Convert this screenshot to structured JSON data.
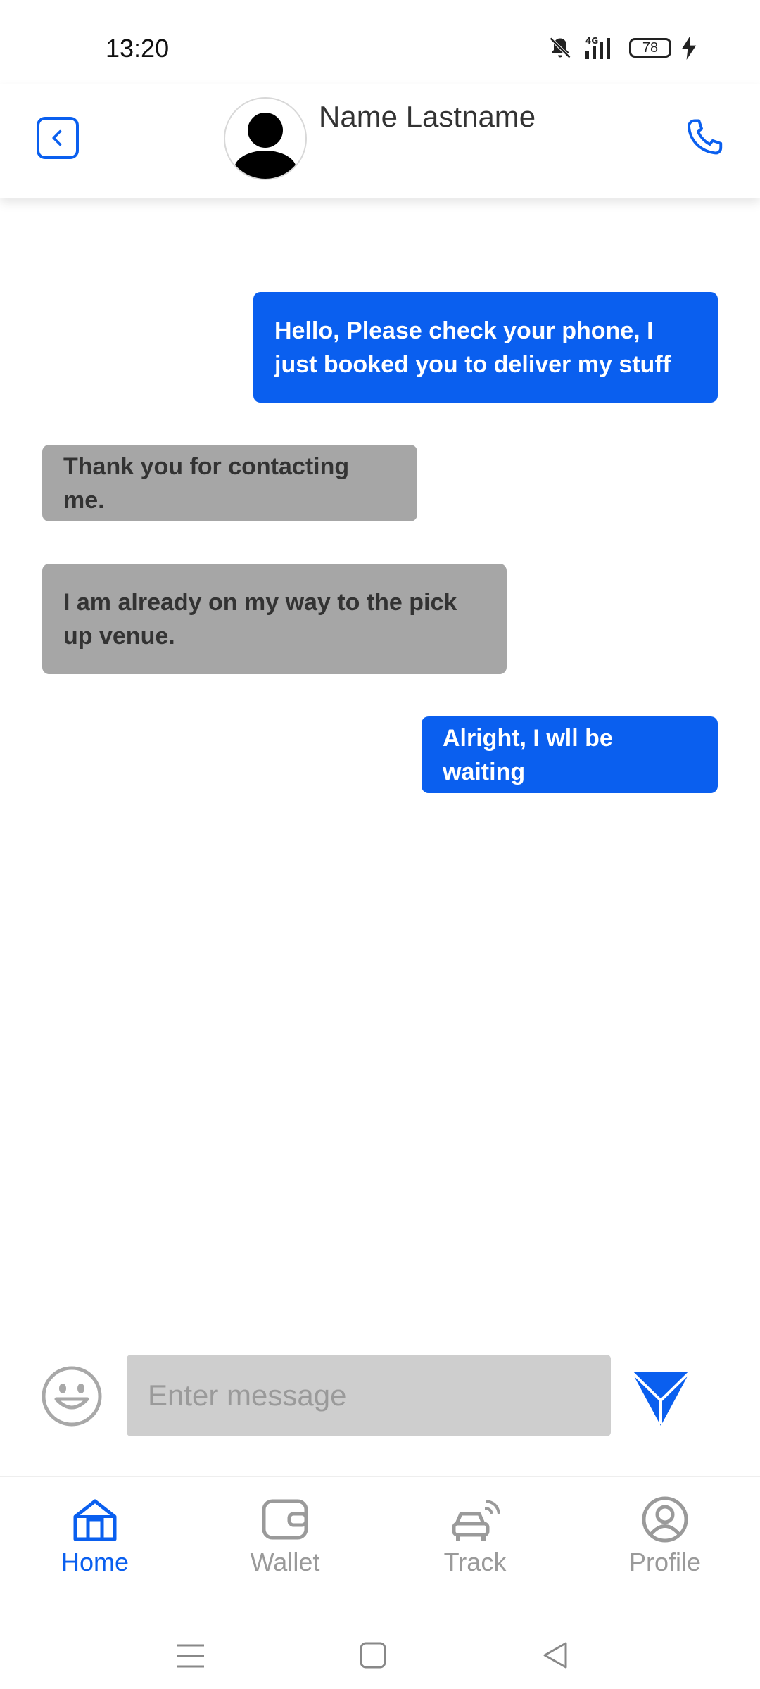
{
  "status_bar": {
    "time": "13:20",
    "battery": "78",
    "network": "4G"
  },
  "header": {
    "contact_name": "Name Lastname"
  },
  "messages": [
    {
      "direction": "outgoing",
      "text": "Hello, Please check your phone, I just booked you to deliver my stuff"
    },
    {
      "direction": "incoming",
      "text": "Thank you for contacting me."
    },
    {
      "direction": "incoming",
      "text": "I am already on my way to the pick up venue."
    },
    {
      "direction": "outgoing",
      "text": "Alright, I wll be waiting"
    }
  ],
  "composer": {
    "placeholder": "Enter message"
  },
  "bottom_nav": {
    "items": [
      {
        "label": "Home",
        "icon": "home-icon",
        "active": true
      },
      {
        "label": "Wallet",
        "icon": "wallet-icon",
        "active": false
      },
      {
        "label": "Track",
        "icon": "car-tracking-icon",
        "active": false
      },
      {
        "label": "Profile",
        "icon": "profile-icon",
        "active": false
      }
    ]
  },
  "colors": {
    "accent": "#0A5FEF",
    "incoming_bubble": "#A6A6A6",
    "input_bg": "#CECECE"
  }
}
